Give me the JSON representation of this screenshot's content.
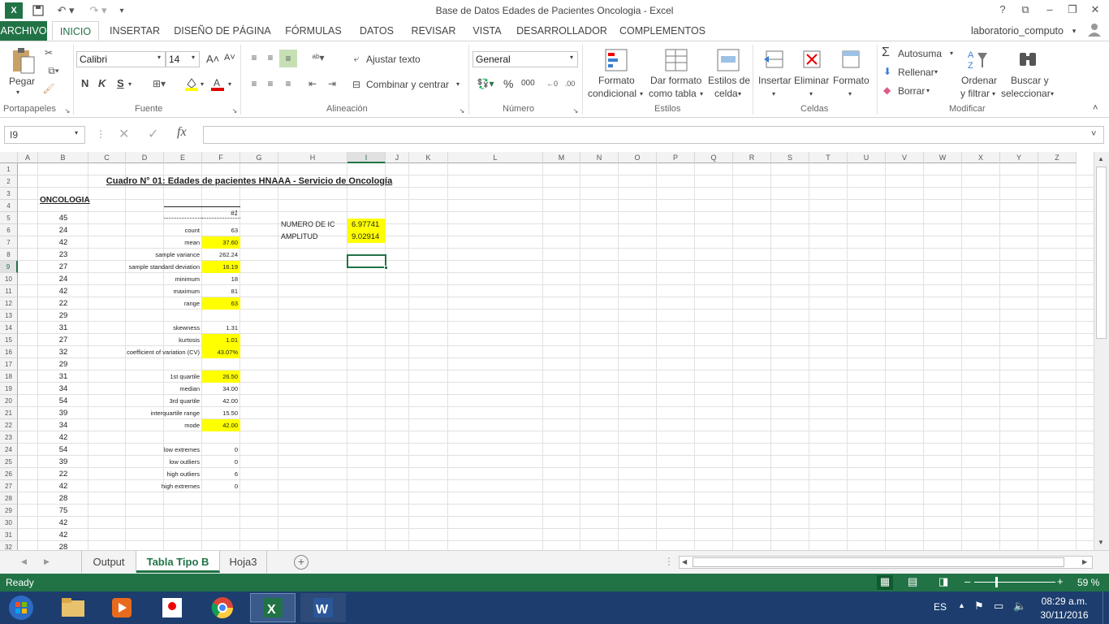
{
  "window": {
    "title": "Base de Datos Edades de Pacientes Oncologia - Excel",
    "user": "laboratorio_computo"
  },
  "tabs": [
    "ARCHIVO",
    "INICIO",
    "INSERTAR",
    "DISEÑO DE PÁGINA",
    "FÓRMULAS",
    "DATOS",
    "REVISAR",
    "VISTA",
    "DESARROLLADOR",
    "COMPLEMENTOS"
  ],
  "ribbon": {
    "clipboard": {
      "paste": "Pegar",
      "label": "Portapapeles"
    },
    "font": {
      "name": "Calibri",
      "size": "14",
      "bold": "N",
      "italic": "K",
      "underline": "S",
      "label": "Fuente"
    },
    "alignment": {
      "wrap": "Ajustar texto",
      "merge": "Combinar y centrar",
      "label": "Alineación"
    },
    "number": {
      "format": "General",
      "percent": "%",
      "thousands": "000",
      "label": "Número"
    },
    "styles": {
      "cond1": "Formato",
      "cond2": "condicional",
      "table1": "Dar formato",
      "table2": "como tabla",
      "cell1": "Estilos de",
      "cell2": "celda",
      "label": "Estilos"
    },
    "cells": {
      "insert": "Insertar",
      "delete": "Eliminar",
      "format": "Formato",
      "label": "Celdas"
    },
    "editing": {
      "autosum": "Autosuma",
      "fill": "Rellenar",
      "clear": "Borrar",
      "sort1": "Ordenar",
      "sort2": "y filtrar",
      "find1": "Buscar y",
      "find2": "seleccionar",
      "label": "Modificar"
    }
  },
  "formula_bar": {
    "name_box": "I9",
    "fx": "fx",
    "content": ""
  },
  "columns": [
    "A",
    "B",
    "C",
    "D",
    "E",
    "F",
    "G",
    "H",
    "I",
    "J",
    "K",
    "L",
    "M",
    "N",
    "O",
    "P",
    "Q",
    "R",
    "S",
    "T",
    "U",
    "V",
    "W",
    "X",
    "Y",
    "Z"
  ],
  "rows": [
    "1",
    "2",
    "3",
    "4",
    "5",
    "6",
    "7",
    "8",
    "9",
    "10",
    "11",
    "12",
    "13",
    "14",
    "15",
    "16",
    "17",
    "18",
    "19",
    "20",
    "21",
    "22",
    "23",
    "24",
    "25",
    "26",
    "27",
    "28",
    "29",
    "30",
    "31",
    "32"
  ],
  "sheet": {
    "title": "Cuadro N° 01: Edades de pacientes HNAAA - Servicio de Oncología",
    "col_header": "ONCOLOGIA",
    "ages": [
      "45",
      "24",
      "42",
      "23",
      "27",
      "24",
      "42",
      "22",
      "29",
      "31",
      "27",
      "32",
      "29",
      "31",
      "34",
      "54",
      "39",
      "34",
      "42",
      "54",
      "39",
      "22",
      "42",
      "28",
      "75",
      "42",
      "42",
      "28"
    ],
    "stats_header": "#1",
    "stats": [
      {
        "label": "count",
        "value": "63",
        "row": 6,
        "hl": false
      },
      {
        "label": "mean",
        "value": "37.60",
        "row": 7,
        "hl": true
      },
      {
        "label": "sample variance",
        "value": "262.24",
        "row": 8,
        "hl": false
      },
      {
        "label": "sample standard deviation",
        "value": "16.19",
        "row": 9,
        "hl": true
      },
      {
        "label": "minimum",
        "value": "18",
        "row": 10,
        "hl": false
      },
      {
        "label": "maximum",
        "value": "81",
        "row": 11,
        "hl": false
      },
      {
        "label": "range",
        "value": "63",
        "row": 12,
        "hl": true
      },
      {
        "label": "skewness",
        "value": "1.31",
        "row": 14,
        "hl": false
      },
      {
        "label": "kurtosis",
        "value": "1.01",
        "row": 15,
        "hl": true
      },
      {
        "label": "coefficient of variation (CV)",
        "value": "43.07%",
        "row": 16,
        "hl": true
      },
      {
        "label": "1st quartile",
        "value": "26.50",
        "row": 18,
        "hl": true
      },
      {
        "label": "median",
        "value": "34.00",
        "row": 19,
        "hl": false
      },
      {
        "label": "3rd quartile",
        "value": "42.00",
        "row": 20,
        "hl": false
      },
      {
        "label": "interquartile range",
        "value": "15.50",
        "row": 21,
        "hl": false
      },
      {
        "label": "mode",
        "value": "42.00",
        "row": 22,
        "hl": true
      },
      {
        "label": "low extremes",
        "value": "0",
        "row": 24,
        "hl": false
      },
      {
        "label": "low outliers",
        "value": "0",
        "row": 25,
        "hl": false
      },
      {
        "label": "high outliers",
        "value": "6",
        "row": 26,
        "hl": false
      },
      {
        "label": "high extremes",
        "value": "0",
        "row": 27,
        "hl": false
      }
    ],
    "ic_label": "NUMERO DE IC",
    "ic_value": "6.97741",
    "amp_label": "AMPLITUD",
    "amp_value": "9.02914"
  },
  "sheet_tabs": [
    "Output",
    "Tabla Tipo B",
    "Hoja3"
  ],
  "status": {
    "ready": "Ready",
    "zoom": "59 %"
  },
  "taskbar": {
    "lang": "ES",
    "time": "08:29 a.m.",
    "date": "30/11/2016"
  }
}
